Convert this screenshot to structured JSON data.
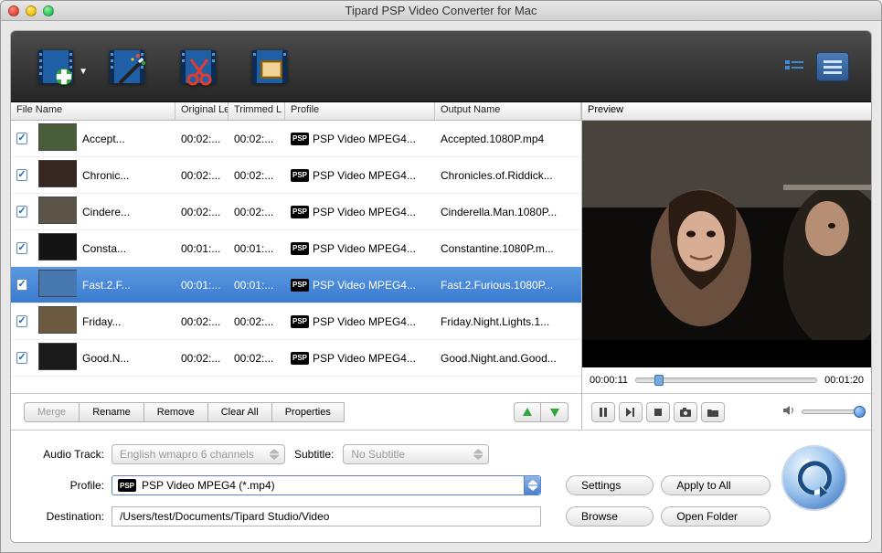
{
  "window": {
    "title": "Tipard PSP Video Converter for Mac"
  },
  "toolbar": {
    "add": "add-file-button",
    "effect": "effect-button",
    "trim": "trim-button",
    "crop": "crop-button"
  },
  "columns": {
    "filename": "File Name",
    "original": "Original Le",
    "trimmed": "Trimmed L",
    "profile": "Profile",
    "output": "Output Name"
  },
  "rows": [
    {
      "checked": true,
      "name": "Accept...",
      "orig": "00:02:...",
      "trim": "00:02:...",
      "profile": "PSP Video MPEG4...",
      "output": "Accepted.1080P.mp4"
    },
    {
      "checked": true,
      "name": "Chronic...",
      "orig": "00:02:...",
      "trim": "00:02:...",
      "profile": "PSP Video MPEG4...",
      "output": "Chronicles.of.Riddick..."
    },
    {
      "checked": true,
      "name": "Cindere...",
      "orig": "00:02:...",
      "trim": "00:02:...",
      "profile": "PSP Video MPEG4...",
      "output": "Cinderella.Man.1080P..."
    },
    {
      "checked": true,
      "name": "Consta...",
      "orig": "00:01:...",
      "trim": "00:01:...",
      "profile": "PSP Video MPEG4...",
      "output": "Constantine.1080P.m..."
    },
    {
      "checked": true,
      "name": "Fast.2.F...",
      "orig": "00:01:...",
      "trim": "00:01:...",
      "profile": "PSP Video MPEG4...",
      "output": "Fast.2.Furious.1080P...",
      "selected": true
    },
    {
      "checked": true,
      "name": "Friday...",
      "orig": "00:02:...",
      "trim": "00:02:...",
      "profile": "PSP Video MPEG4...",
      "output": "Friday.Night.Lights.1..."
    },
    {
      "checked": true,
      "name": "Good.N...",
      "orig": "00:02:...",
      "trim": "00:02:...",
      "profile": "PSP Video MPEG4...",
      "output": "Good.Night.and.Good..."
    }
  ],
  "actions": {
    "merge": "Merge",
    "rename": "Rename",
    "remove": "Remove",
    "clear": "Clear All",
    "properties": "Properties"
  },
  "preview": {
    "label": "Preview",
    "current": "00:00:11",
    "total": "00:01:20"
  },
  "form": {
    "audio_label": "Audio Track:",
    "audio_value": "English wmapro 6 channels",
    "subtitle_label": "Subtitle:",
    "subtitle_value": "No Subtitle",
    "profile_label": "Profile:",
    "profile_value": "PSP Video MPEG4 (*.mp4)",
    "dest_label": "Destination:",
    "dest_value": "/Users/test/Documents/Tipard Studio/Video",
    "settings": "Settings",
    "apply_all": "Apply to All",
    "browse": "Browse",
    "open_folder": "Open Folder"
  }
}
